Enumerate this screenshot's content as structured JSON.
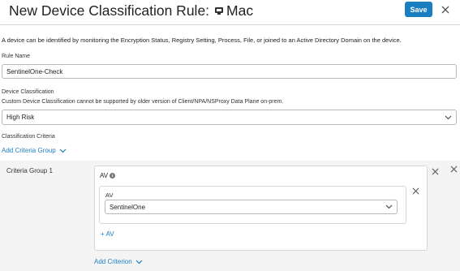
{
  "header": {
    "title": "New Device Classification Rule:",
    "os_icon": "apple-laptop-icon",
    "os_name": "Mac",
    "save_label": "Save"
  },
  "intro_text": "A device can be identified by monitoring the Encryption Status, Registry Setting, Process, File, or joined to an Active Directory Domain on the device.",
  "rule_name": {
    "label": "Rule Name",
    "value": "SentinelOne-Check"
  },
  "device_classification": {
    "label": "Device Classification",
    "note": "Custom Device Classification cannot be supported by older version of Client/NPA/NSProxy Data Plane on-prem.",
    "selected": "High Risk"
  },
  "classification_criteria": {
    "label": "Classification Criteria",
    "add_group_label": "Add Criteria Group"
  },
  "criteria_group": {
    "title": "Criteria Group 1",
    "criterion": {
      "title": "AV",
      "entry_label": "AV",
      "entry_selected": "SentinelOne",
      "add_label": "+ AV"
    },
    "add_criterion_label": "Add Criterion"
  },
  "colors": {
    "accent": "#1a7fc1",
    "group_bg": "#f4f4f4"
  }
}
